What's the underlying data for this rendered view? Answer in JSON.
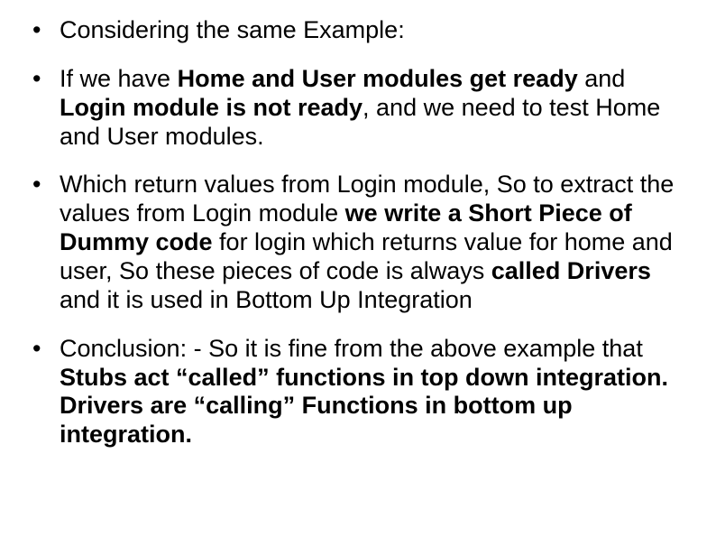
{
  "bullets": [
    {
      "segments": [
        {
          "text": "Considering the same Example:",
          "bold": false
        }
      ]
    },
    {
      "segments": [
        {
          "text": "If we have ",
          "bold": false
        },
        {
          "text": "Home and User modules get ready",
          "bold": true
        },
        {
          "text": " and ",
          "bold": false
        },
        {
          "text": "Login module is not ready",
          "bold": true
        },
        {
          "text": ", and we need to test Home and User modules.",
          "bold": false
        }
      ]
    },
    {
      "segments": [
        {
          "text": "Which return values from Login module, So to extract the values from Login module ",
          "bold": false
        },
        {
          "text": "we write a Short Piece of Dummy code",
          "bold": true
        },
        {
          "text": " for login which returns value for home and user, So these pieces of code is always ",
          "bold": false
        },
        {
          "text": "called Drivers",
          "bold": true
        },
        {
          "text": " and it is used in Bottom Up Integration",
          "bold": false
        }
      ]
    },
    {
      "segments": [
        {
          "text": "Conclusion: - So it is fine from the above example that ",
          "bold": false
        },
        {
          "text": "Stubs act “called” functions in top down integration. Drivers are “calling” Functions in bottom up integration.",
          "bold": true
        }
      ]
    }
  ]
}
